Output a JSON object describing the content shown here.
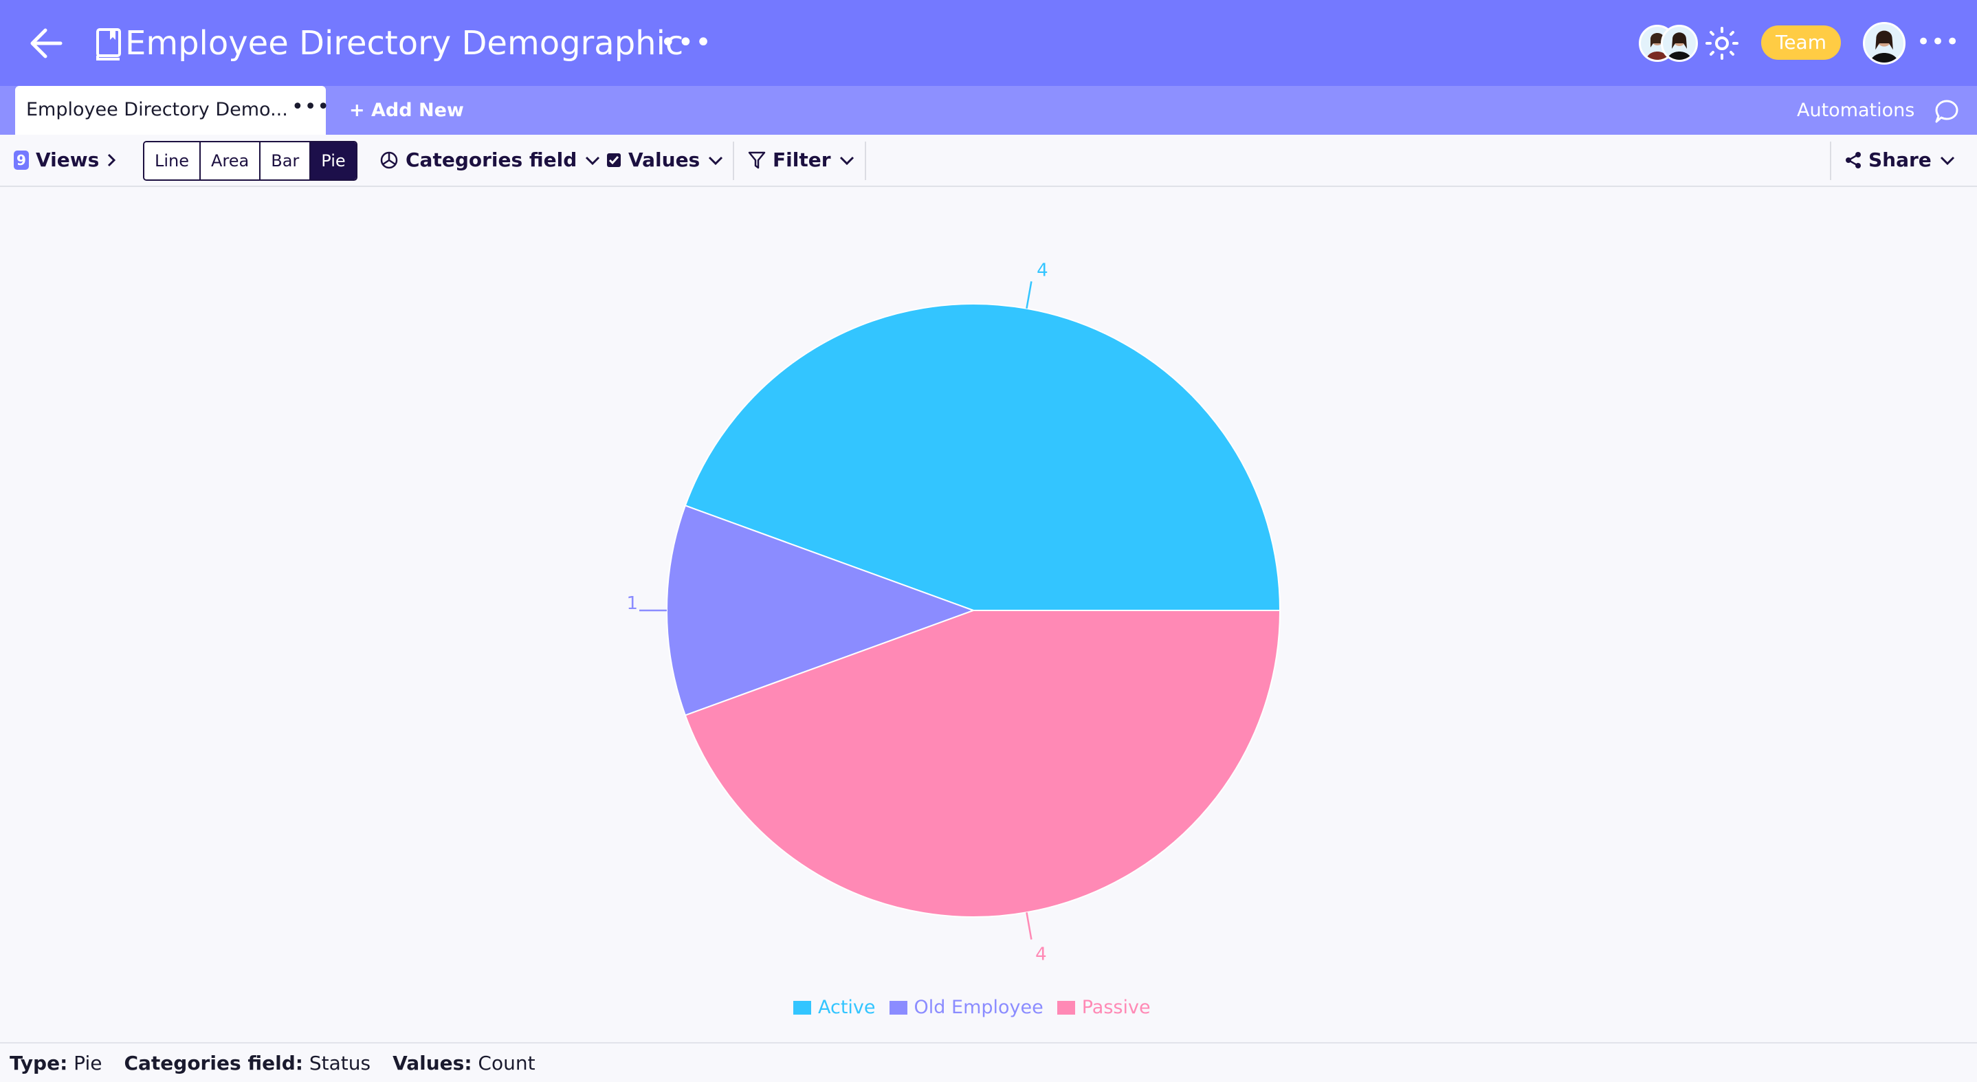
{
  "header": {
    "title": "Employee Directory Demographic",
    "more_label": "•••",
    "team_badge": "Team",
    "user_more_label": "•••",
    "icons": {
      "back": "arrow-left-icon",
      "book": "book-icon",
      "theme": "sun-icon"
    }
  },
  "tabs": {
    "active_tab_label": "Employee Directory Demo...",
    "active_tab_more": "•••",
    "add_new_label": "+ Add New",
    "automations_label": "Automations"
  },
  "toolbar": {
    "views_badge": "9",
    "views_label": "Views",
    "chart_types": [
      "Line",
      "Area",
      "Bar",
      "Pie"
    ],
    "active_chart_type": "Pie",
    "categories_label": "Categories field",
    "values_label": "Values",
    "filter_label": "Filter",
    "share_label": "Share"
  },
  "chart_data": {
    "type": "pie",
    "title": "",
    "categories": [
      "Active",
      "Old Employee",
      "Passive"
    ],
    "values": [
      4,
      1,
      4
    ],
    "colors": [
      "#33c5ff",
      "#8b8cff",
      "#ff89b5"
    ],
    "data_labels": [
      "4",
      "1",
      "4"
    ],
    "legend": {
      "position": "bottom",
      "entries": [
        "Active",
        "Old Employee",
        "Passive"
      ]
    }
  },
  "footer": {
    "type_label": "Type:",
    "type_value": "Pie",
    "categories_label": "Categories field:",
    "categories_value": "Status",
    "values_label": "Values:",
    "values_value": "Count"
  }
}
